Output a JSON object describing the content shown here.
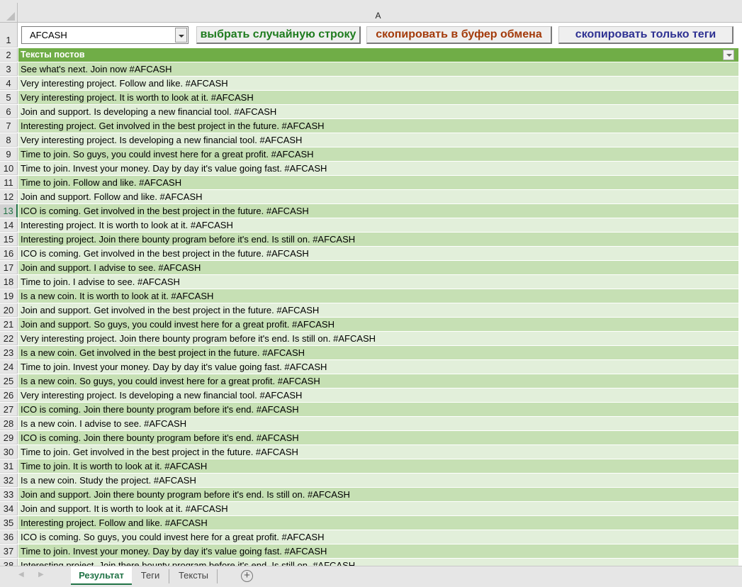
{
  "column_header": "A",
  "controls": {
    "combo_value": "AFCASH",
    "btn_random": "выбрать случайную строку",
    "btn_copy": "скопировать в буфер обмена",
    "btn_tags": "скопировать только теги",
    "colors": {
      "random": "#1e7b1e",
      "copy": "#a33a0a",
      "tags": "#2e3192"
    }
  },
  "header_row": {
    "num": "2",
    "label": "Тексты постов"
  },
  "rows": [
    {
      "n": "3",
      "t": "See what's next. Join now  #AFCASH"
    },
    {
      "n": "4",
      "t": "Very interesting project. Follow and like. #AFCASH"
    },
    {
      "n": "5",
      "t": "Very interesting project. It is worth to look at it.  #AFCASH"
    },
    {
      "n": "6",
      "t": "Join and support. Is developing a new financial tool.  #AFCASH"
    },
    {
      "n": "7",
      "t": "Interesting project. Get involved in the best project in the future.  #AFCASH"
    },
    {
      "n": "8",
      "t": "Very interesting project. Is developing a new financial tool.  #AFCASH"
    },
    {
      "n": "9",
      "t": "Time to join. So guys, you could invest here for a great profit.  #AFCASH"
    },
    {
      "n": "10",
      "t": "Time to join. Invest your money. Day by day it's value going fast.  #AFCASH"
    },
    {
      "n": "11",
      "t": "Time to join. Follow and like.  #AFCASH"
    },
    {
      "n": "12",
      "t": "Join and support. Follow and like.  #AFCASH"
    },
    {
      "n": "13",
      "t": "ICO is coming. Get involved in the best project in the future.  #AFCASH"
    },
    {
      "n": "14",
      "t": "Interesting project. It is worth to look at it.  #AFCASH"
    },
    {
      "n": "15",
      "t": "Interesting project. Join there bounty program before it's end. Is still on.  #AFCASH"
    },
    {
      "n": "16",
      "t": "ICO is coming. Get involved in the best project in the future.  #AFCASH"
    },
    {
      "n": "17",
      "t": "Join and support. I advise to see.  #AFCASH"
    },
    {
      "n": "18",
      "t": "Time to join. I advise to see.  #AFCASH"
    },
    {
      "n": "19",
      "t": "Is a new coin. It is worth to look at it.  #AFCASH"
    },
    {
      "n": "20",
      "t": "Join and support. Get involved in the best project in the future.  #AFCASH"
    },
    {
      "n": "21",
      "t": "Join and support. So guys, you could invest here for a great profit.  #AFCASH"
    },
    {
      "n": "22",
      "t": "Very interesting project. Join there bounty program before it's end. Is still on.  #AFCASH"
    },
    {
      "n": "23",
      "t": "Is a new coin. Get involved in the best project in the future.  #AFCASH"
    },
    {
      "n": "24",
      "t": "Time to join. Invest your money. Day by day it's value going fast.  #AFCASH"
    },
    {
      "n": "25",
      "t": "Is a new coin. So guys, you could invest here for a great profit.  #AFCASH"
    },
    {
      "n": "26",
      "t": "Very interesting project. Is developing a new financial tool.  #AFCASH"
    },
    {
      "n": "27",
      "t": "ICO is coming. Join there bounty program before it's end.  #AFCASH"
    },
    {
      "n": "28",
      "t": "Is a new coin. I advise to see.  #AFCASH"
    },
    {
      "n": "29",
      "t": "ICO is coming. Join there bounty program before it's end.  #AFCASH"
    },
    {
      "n": "30",
      "t": "Time to join. Get involved in the best project in the future.  #AFCASH"
    },
    {
      "n": "31",
      "t": "Time to join. It is worth to look at it.  #AFCASH"
    },
    {
      "n": "32",
      "t": "Is a new coin. Study the project.  #AFCASH"
    },
    {
      "n": "33",
      "t": "Join and support. Join there bounty program before it's end. Is still on.  #AFCASH"
    },
    {
      "n": "34",
      "t": "Join and support. It is worth to look at it.  #AFCASH"
    },
    {
      "n": "35",
      "t": "Interesting project. Follow and like.  #AFCASH"
    },
    {
      "n": "36",
      "t": "ICO is coming. So guys, you could invest here for a great profit.  #AFCASH"
    },
    {
      "n": "37",
      "t": "Time to join. Invest your money. Day by day it's value going fast.  #AFCASH"
    },
    {
      "n": "38",
      "t": "Interesting project. Join there bounty program before it's end. Is still on.  #AFCASH"
    }
  ],
  "selected_row": "13",
  "sheets": [
    {
      "label": "Результат",
      "active": true
    },
    {
      "label": "Теги"
    },
    {
      "label": "Тексты"
    }
  ]
}
